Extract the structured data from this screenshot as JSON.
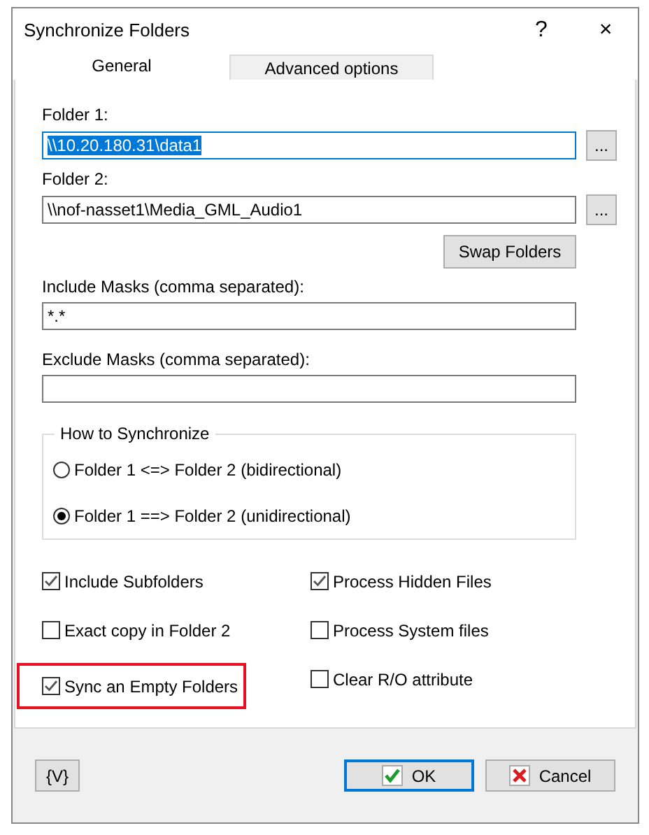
{
  "window": {
    "title": "Synchronize Folders",
    "help": "?",
    "close": "×"
  },
  "tabs": [
    {
      "label": "General",
      "selected": true
    },
    {
      "label": "Advanced options",
      "selected": false
    }
  ],
  "folders": [
    {
      "label": "Folder 1:",
      "value": "\\\\10.20.180.31\\data1",
      "focused": true,
      "text_selected": true,
      "browse": "..."
    },
    {
      "label": "Folder 2:",
      "value": "\\\\nof-nasset1\\Media_GML_Audio1",
      "focused": false,
      "text_selected": false,
      "browse": "..."
    }
  ],
  "swap_button": "Swap Folders",
  "masks": [
    {
      "label": "Include Masks (comma separated):",
      "value": "*.*"
    },
    {
      "label": "Exclude Masks (comma separated):"
    }
  ],
  "sync_mode": {
    "title": "How to Synchronize",
    "options": [
      {
        "label": "Folder 1 <=> Folder 2 (bidirectional)",
        "selected": false
      },
      {
        "label": "Folder 1 ==> Folder 2 (unidirectional)",
        "selected": true
      }
    ]
  },
  "options": [
    {
      "label": "Include Subfolders",
      "checked": true,
      "highlighted": false
    },
    {
      "label": "Process Hidden Files",
      "checked": true,
      "highlighted": false
    },
    {
      "label": "Exact copy in Folder 2",
      "checked": false,
      "highlighted": false
    },
    {
      "label": "Process System files",
      "checked": false,
      "highlighted": false
    },
    {
      "label": "Sync an Empty Folders",
      "checked": true,
      "highlighted": true
    },
    {
      "label": "Clear R/O attribute",
      "checked": false,
      "highlighted": false
    }
  ],
  "footer": {
    "variables_button": "{V}",
    "ok": "OK",
    "cancel": "Cancel"
  }
}
